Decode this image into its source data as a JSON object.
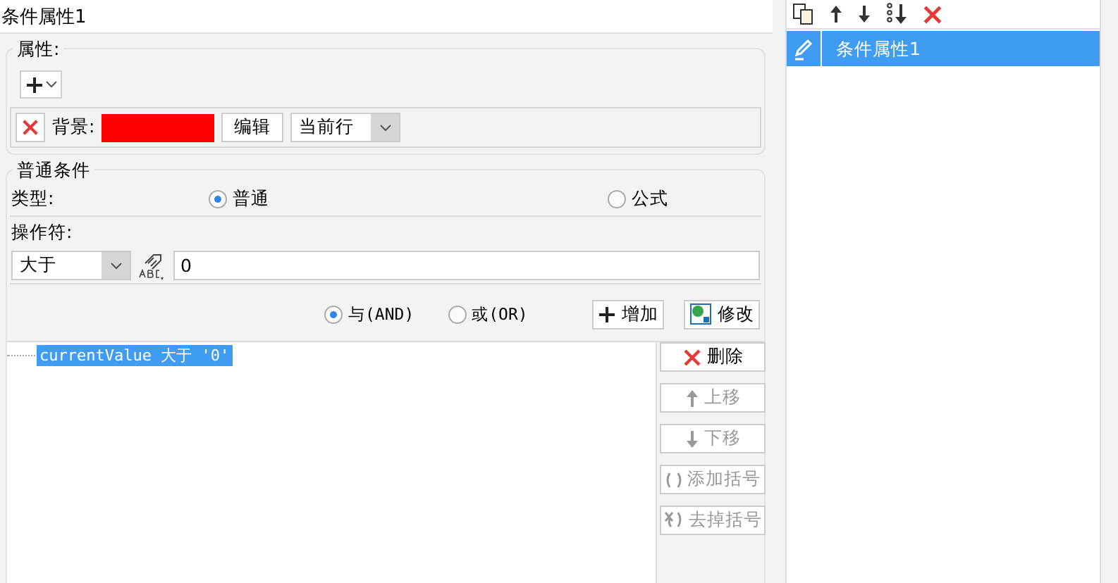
{
  "panel_title": "条件属性1",
  "properties": {
    "label": "属性:",
    "background": {
      "label": "背景:",
      "color": "#ff0000",
      "edit_button": "编辑",
      "scope": "当前行"
    }
  },
  "condition": {
    "label": "普通条件",
    "type_label": "类型:",
    "types": [
      {
        "label": "普通",
        "selected": true
      },
      {
        "label": "公式",
        "selected": false
      }
    ],
    "operator_label": "操作符:",
    "operator": "大于",
    "value": "0",
    "joins": [
      {
        "label": "与(AND)",
        "selected": true
      },
      {
        "label": "或(OR)",
        "selected": false
      }
    ],
    "actions": [
      {
        "kind": "add",
        "label": "增加"
      },
      {
        "kind": "modify",
        "label": "修改"
      }
    ],
    "items": [
      {
        "text": "currentValue 大于 '0'",
        "selected": true
      }
    ],
    "list_buttons": [
      {
        "kind": "delete",
        "label": "删除",
        "disabled": false
      },
      {
        "kind": "up",
        "label": "上移",
        "disabled": true
      },
      {
        "kind": "down",
        "label": "下移",
        "disabled": true
      },
      {
        "kind": "add-paren",
        "label": "添加括号",
        "disabled": true
      },
      {
        "kind": "remove-paren",
        "label": "去掉括号",
        "disabled": true
      }
    ]
  },
  "attribute_list": {
    "items": [
      {
        "label": "条件属性1",
        "selected": true
      }
    ]
  }
}
